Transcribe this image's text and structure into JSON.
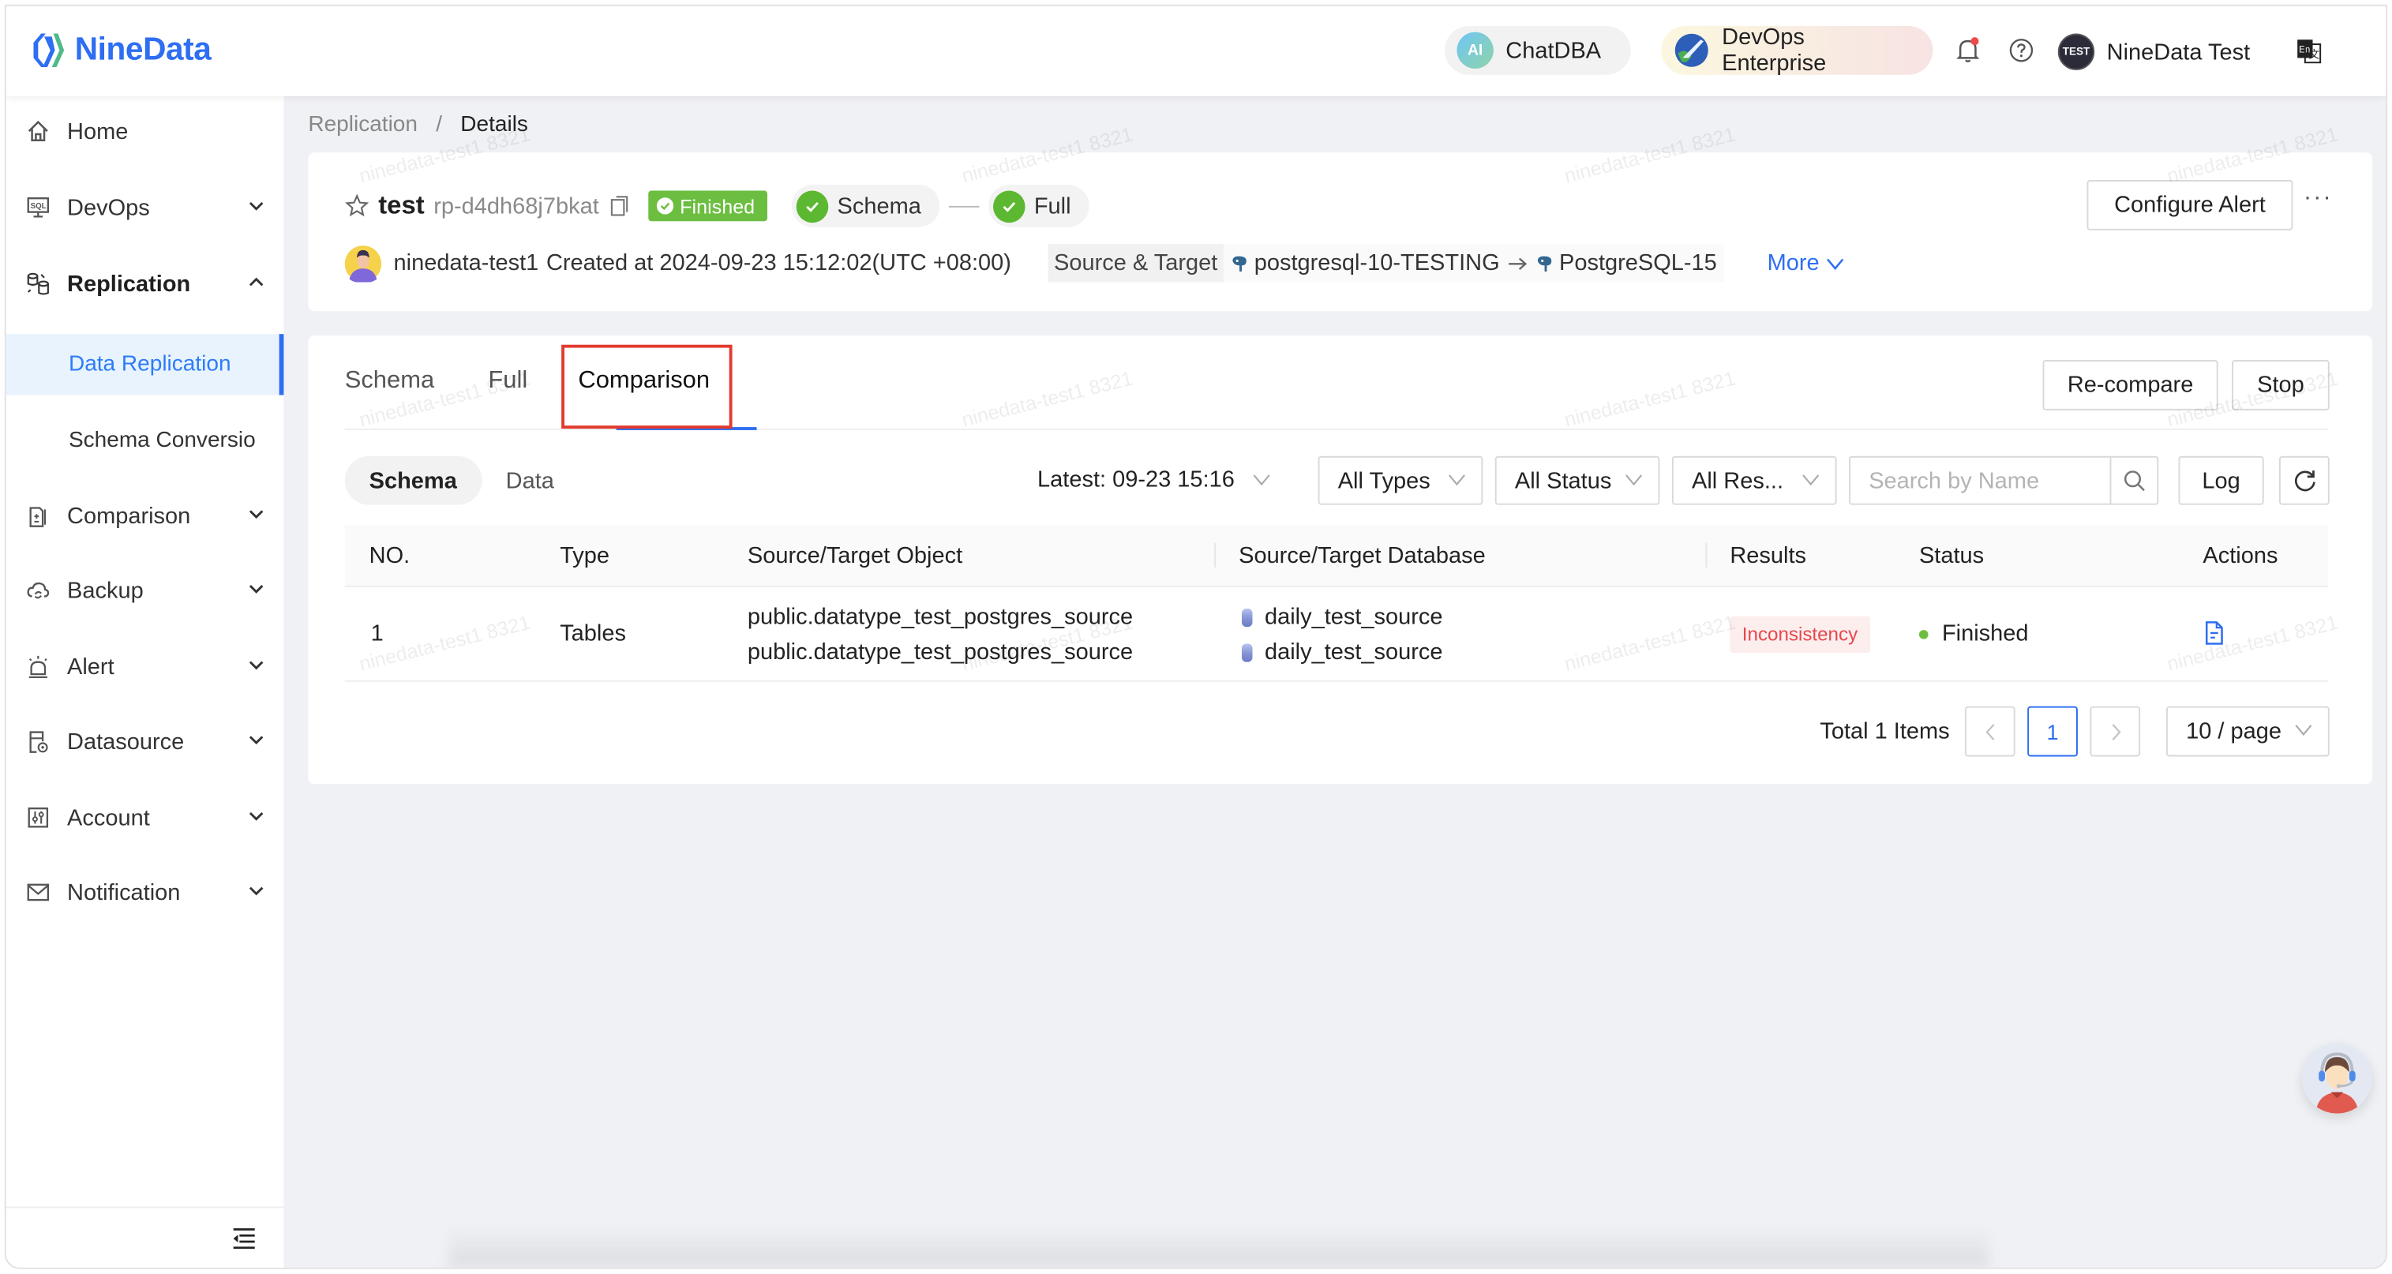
{
  "app": {
    "brand": "NineData"
  },
  "topbar": {
    "chatdba_label": "ChatDBA",
    "chatdba_icon_text": "AI",
    "devops_label": "DevOps Enterprise",
    "user_name": "NineData Test",
    "user_avatar_text": "TEST",
    "notification_has_dot": true
  },
  "sidebar": {
    "items": [
      {
        "label": "Home",
        "icon": "home-icon"
      },
      {
        "label": "DevOps",
        "icon": "sql-monitor-icon",
        "expandable": true
      },
      {
        "label": "Replication",
        "icon": "replication-icon",
        "expanded": true
      },
      {
        "label": "Comparison",
        "icon": "compare-doc-icon",
        "expandable": true
      },
      {
        "label": "Backup",
        "icon": "cloud-sync-icon",
        "expandable": true
      },
      {
        "label": "Alert",
        "icon": "alarm-icon",
        "expandable": true
      },
      {
        "label": "Datasource",
        "icon": "datasource-icon",
        "expandable": true
      },
      {
        "label": "Account",
        "icon": "sliders-icon",
        "expandable": true
      },
      {
        "label": "Notification",
        "icon": "mail-icon",
        "expandable": true
      }
    ],
    "sub_items": [
      {
        "label": "Data Replication",
        "active": true
      },
      {
        "label": "Schema Conversio"
      }
    ]
  },
  "breadcrumb": {
    "parent": "Replication",
    "separator": "/",
    "current": "Details"
  },
  "job": {
    "name": "test",
    "id": "rp-d4dh68j7bkat",
    "status": "Finished",
    "stages": [
      "Schema",
      "Full"
    ],
    "creator": "ninedata-test1",
    "created_text": "Created at 2024-09-23 15:12:02(UTC +08:00)",
    "source_target_label": "Source & Target",
    "source": "postgresql-10-TESTING",
    "target": "PostgreSQL-15",
    "more_label": "More",
    "configure_alert_label": "Configure Alert",
    "more_actions_label": "···"
  },
  "tabs": {
    "items": [
      "Schema",
      "Full",
      "Comparison"
    ],
    "active": "Comparison",
    "recompare_label": "Re-compare",
    "stop_label": "Stop"
  },
  "comparison": {
    "segments": [
      "Schema",
      "Data"
    ],
    "active_segment": "Schema",
    "latest_label": "Latest: 09-23 15:16",
    "filters": [
      "All Types",
      "All Status",
      "All Res..."
    ],
    "search_placeholder": "Search by Name",
    "search_value": "",
    "log_label": "Log",
    "columns": [
      "NO.",
      "Type",
      "Source/Target Object",
      "Source/Target Database",
      "Results",
      "Status",
      "Actions"
    ],
    "rows": [
      {
        "no": "1",
        "type": "Tables",
        "source_object": "public.datatype_test_postgres_source",
        "target_object": "public.datatype_test_postgres_source",
        "source_db": "daily_test_source",
        "target_db": "daily_test_source",
        "result": "Inconsistency",
        "status": "Finished"
      }
    ],
    "pagination": {
      "total_text": "Total 1 Items",
      "current_page": "1",
      "page_size_label": "10 / page"
    }
  },
  "watermark": "ninedata-test1 8321",
  "colors": {
    "brand": "#2e6ef2",
    "success": "#6cbe40",
    "danger": "#e5484d",
    "highlight_box": "#e23a2e"
  }
}
